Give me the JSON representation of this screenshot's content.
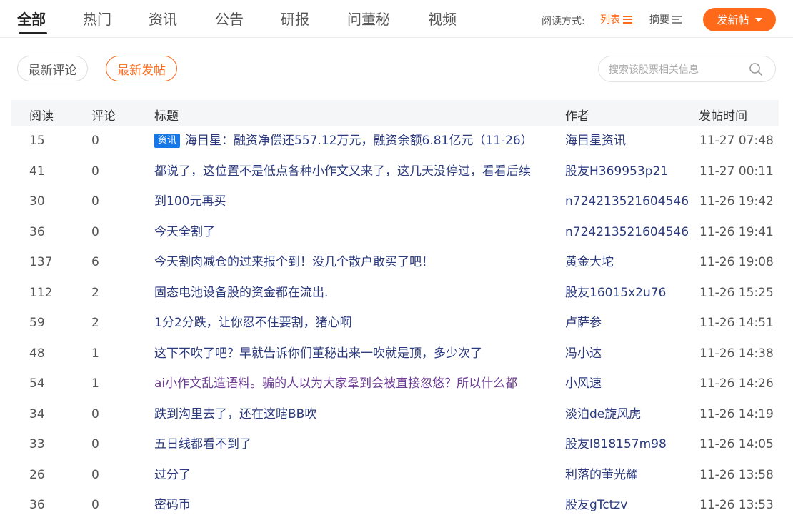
{
  "nav": {
    "tabs": [
      "全部",
      "热门",
      "资讯",
      "公告",
      "研报",
      "问董秘",
      "视频"
    ],
    "active_tab": "全部",
    "read_mode_label": "阅读方式:",
    "mode_list_label": "列表",
    "mode_summary_label": "摘要",
    "post_button_label": "发新帖"
  },
  "filters": {
    "latest_comment_label": "最新评论",
    "latest_post_label": "最新发帖",
    "active": "最新发帖"
  },
  "search": {
    "placeholder": "搜索该股票相关信息",
    "value": "",
    "icon": "search-icon"
  },
  "table": {
    "headers": {
      "read": "阅读",
      "comments": "评论",
      "title": "标题",
      "author": "作者",
      "time": "发帖时间"
    },
    "rows": [
      {
        "read": "15",
        "comments": "0",
        "tag": "资讯",
        "title": "海目星：融资净偿还557.12万元，融资余额6.81亿元（11-26）",
        "author": "海目星资讯",
        "time": "11-27 07:48",
        "visited": false
      },
      {
        "read": "41",
        "comments": "0",
        "title": "都说了，这位置不是低点各种小作文又来了，这几天没停过，看看后续",
        "author": "股友H369953p21",
        "time": "11-27 00:11",
        "visited": false
      },
      {
        "read": "30",
        "comments": "0",
        "title": "到100元再买",
        "author": "n724213521604546",
        "time": "11-26 19:42",
        "visited": false
      },
      {
        "read": "36",
        "comments": "0",
        "title": "今天全割了",
        "author": "n724213521604546",
        "time": "11-26 19:41",
        "visited": false
      },
      {
        "read": "137",
        "comments": "6",
        "title": "今天割肉减仓的过来报个到！没几个散户敢买了吧！",
        "author": "黄金大坨",
        "time": "11-26 19:08",
        "visited": false
      },
      {
        "read": "112",
        "comments": "2",
        "title": "固态电池设备股的资金都在流出.",
        "author": "股友16015x2u76",
        "time": "11-26 15:25",
        "visited": false
      },
      {
        "read": "59",
        "comments": "2",
        "title": "1分2分跌，让你忍不住要割，猪心啊",
        "author": "卢萨参",
        "time": "11-26 14:51",
        "visited": false
      },
      {
        "read": "48",
        "comments": "1",
        "title": "这下不吹了吧？早就告诉你们董秘出来一吹就是顶，多少次了",
        "author": "冯小达",
        "time": "11-26 14:38",
        "visited": false
      },
      {
        "read": "54",
        "comments": "1",
        "title": "ai小作文乱造语料。骗的人以为大家羣到会被直接忽悠？所以什么都",
        "author": "小风速",
        "time": "11-26 14:26",
        "visited": true
      },
      {
        "read": "34",
        "comments": "0",
        "title": "跌到沟里去了，还在这瞎BB吹",
        "author": "淡泊de旋风虎",
        "time": "11-26 14:19",
        "visited": false
      },
      {
        "read": "33",
        "comments": "0",
        "title": "五日线都看不到了",
        "author": "股友l818157m98",
        "time": "11-26 14:05",
        "visited": false
      },
      {
        "read": "26",
        "comments": "0",
        "title": "过分了",
        "author": "利落的董光耀",
        "time": "11-26 13:58",
        "visited": false
      },
      {
        "read": "36",
        "comments": "0",
        "title": "密码币",
        "author": "股友gTctzv",
        "time": "11-26 13:53",
        "visited": false
      }
    ]
  },
  "colors": {
    "accent": "#ff6a1a",
    "link": "#2b3a7d",
    "visited": "#6b3c91",
    "tag_bg": "#1677e8"
  }
}
